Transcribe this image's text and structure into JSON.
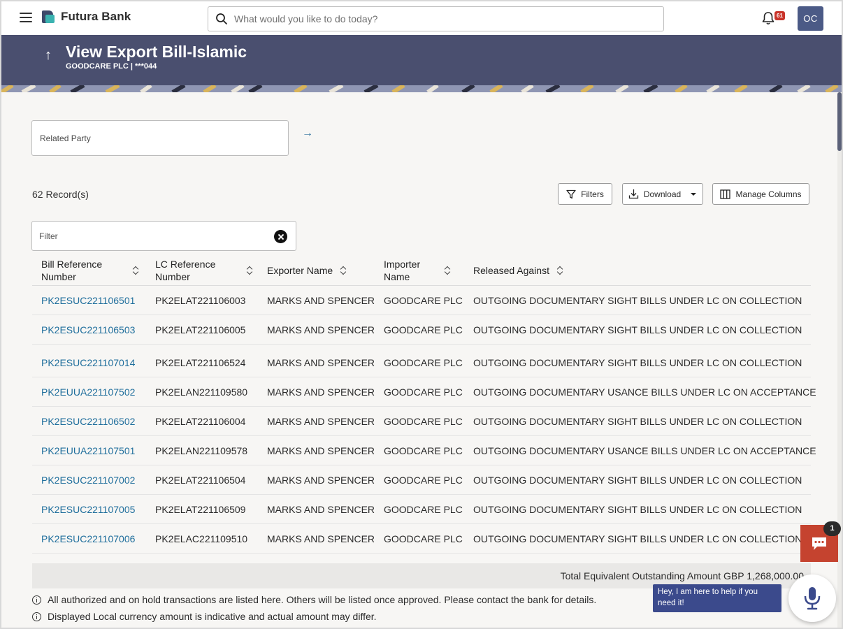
{
  "topbar": {
    "brand": "Futura Bank",
    "search_placeholder": "What would you like to do today?",
    "notification_count": "61",
    "avatar_initials": "OC"
  },
  "header": {
    "title": "View Export Bill-Islamic",
    "subtitle": "GOODCARE PLC | ***044"
  },
  "main": {
    "related_party_label": "Related Party",
    "records_count": "62 Record(s)",
    "buttons": {
      "filters": "Filters",
      "download": "Download",
      "manage_columns": "Manage Columns"
    },
    "filter_placeholder": "Filter"
  },
  "table": {
    "columns": [
      "Bill Reference Number",
      "LC Reference Number",
      "Exporter Name",
      "Importer Name",
      "Released Against"
    ],
    "rows": [
      [
        "PK2ESUC221106501",
        "PK2ELAT221106003",
        "MARKS AND SPENCER",
        "GOODCARE PLC",
        "OUTGOING DOCUMENTARY SIGHT BILLS UNDER LC ON COLLECTION"
      ],
      [
        "PK2ESUC221106503",
        "PK2ELAT221106005",
        "MARKS AND SPENCER",
        "GOODCARE PLC",
        "OUTGOING DOCUMENTARY SIGHT BILLS UNDER LC ON COLLECTION"
      ],
      [
        "PK2ESUC221107014",
        "PK2ELAT221106524",
        "MARKS AND SPENCER",
        "GOODCARE PLC",
        "OUTGOING DOCUMENTARY SIGHT BILLS UNDER LC ON COLLECTION"
      ],
      [
        "PK2EUUA221107502",
        "PK2ELAN221109580",
        "MARKS AND SPENCER",
        "GOODCARE PLC",
        "OUTGOING DOCUMENTARY USANCE BILLS UNDER LC ON ACCEPTANCE"
      ],
      [
        "PK2ESUC221106502",
        "PK2ELAT221106004",
        "MARKS AND SPENCER",
        "GOODCARE PLC",
        "OUTGOING DOCUMENTARY SIGHT BILLS UNDER LC ON COLLECTION"
      ],
      [
        "PK2EUUA221107501",
        "PK2ELAN221109578",
        "MARKS AND SPENCER",
        "GOODCARE PLC",
        "OUTGOING DOCUMENTARY USANCE BILLS UNDER LC ON ACCEPTANCE"
      ],
      [
        "PK2ESUC221107002",
        "PK2ELAT221106504",
        "MARKS AND SPENCER",
        "GOODCARE PLC",
        "OUTGOING DOCUMENTARY SIGHT BILLS UNDER LC ON COLLECTION"
      ],
      [
        "PK2ESUC221107005",
        "PK2ELAT221106509",
        "MARKS AND SPENCER",
        "GOODCARE PLC",
        "OUTGOING DOCUMENTARY SIGHT BILLS UNDER LC ON COLLECTION"
      ],
      [
        "PK2ESUC221107006",
        "PK2ELAC221109510",
        "MARKS AND SPENCER",
        "GOODCARE PLC",
        "OUTGOING DOCUMENTARY SIGHT BILLS UNDER LC ON COLLECTION"
      ]
    ],
    "total": "Total Equivalent Outstanding Amount GBP 1,268,000.00"
  },
  "notes": [
    "All authorized and on hold transactions are listed here. Others will be listed once approved. Please contact the bank for details.",
    "Displayed Local currency amount is indicative and actual amount may differ."
  ],
  "chat": {
    "badge": "1",
    "bot_message": "Hey, I am here to help if you need it!"
  },
  "colors": {
    "header_bg": "#4a4f6f",
    "link": "#1f6e9c",
    "chat_button": "#c5432f",
    "badge": "#c9342a"
  }
}
